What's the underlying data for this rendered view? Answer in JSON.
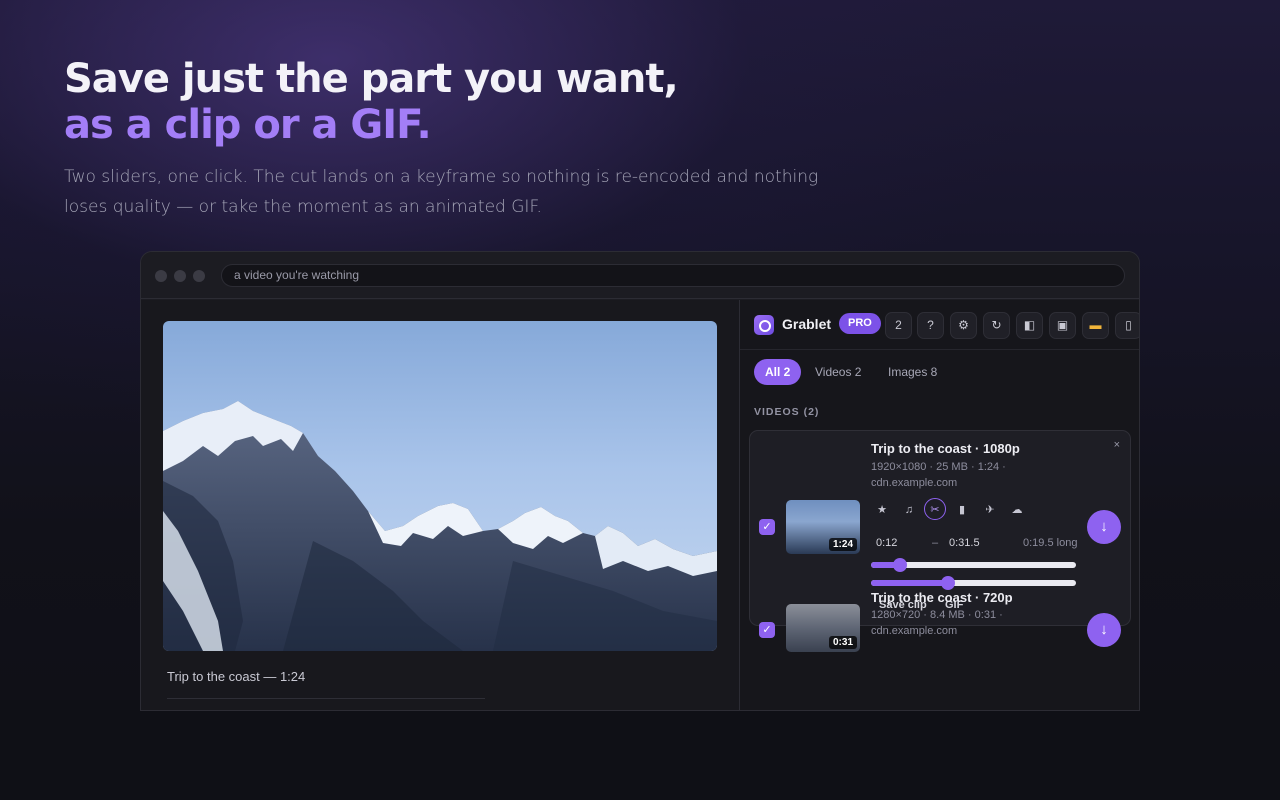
{
  "hero": {
    "title_line1": "Save just the part you want,",
    "title_line2": "as a clip or a GIF.",
    "subtitle": "Two sliders, one click. The cut lands on a keyframe so nothing is re-encoded and nothing loses quality — or take the moment as an animated GIF."
  },
  "browser": {
    "url": "a video you're watching",
    "video_caption": "Trip to the coast — 1:24"
  },
  "panel": {
    "brand": "Grablet",
    "badge": "PRO",
    "header_buttons": [
      {
        "icon": "count",
        "label": "2"
      },
      {
        "icon": "help-icon",
        "label": "?"
      },
      {
        "icon": "gear-icon",
        "label": "⚙"
      },
      {
        "icon": "refresh-icon",
        "label": "↻"
      },
      {
        "icon": "gallery-icon",
        "label": "◧"
      },
      {
        "icon": "image-icon",
        "label": "▣"
      },
      {
        "icon": "folder-icon",
        "label": "▬"
      },
      {
        "icon": "trash-icon",
        "label": "▯"
      }
    ],
    "tabs": [
      "All 2",
      "Videos 2",
      "Images 8"
    ],
    "section_label": "VIDEOS (2)",
    "items": [
      {
        "title": "Trip to the coast · 1080p",
        "meta_line1": "1920×1080 · 25 MB · 1:24 ·",
        "meta_line2": "cdn.example.com",
        "duration": "1:24",
        "close": "×",
        "tools": [
          "★",
          "♫",
          "✂",
          "▮",
          "✈",
          "☁"
        ],
        "clip_start": "0:12",
        "clip_sep": "–",
        "clip_end": "0:31.5",
        "clip_length": "0:19.5 long",
        "slider_start_fraction": 0.143,
        "slider_end_fraction": 0.375,
        "save_clip_label": "Save clip",
        "gif_label": "GIF",
        "download": "↓"
      },
      {
        "title": "Trip to the coast · 720p",
        "meta_line1": "1280×720 · 8.4 MB · 0:31 ·",
        "meta_line2": "cdn.example.com",
        "duration": "0:31",
        "download": "↓"
      }
    ],
    "check_glyph": "✓"
  },
  "colors": {
    "accent": "#8e62f0",
    "title_accent": "#a37ef7"
  }
}
